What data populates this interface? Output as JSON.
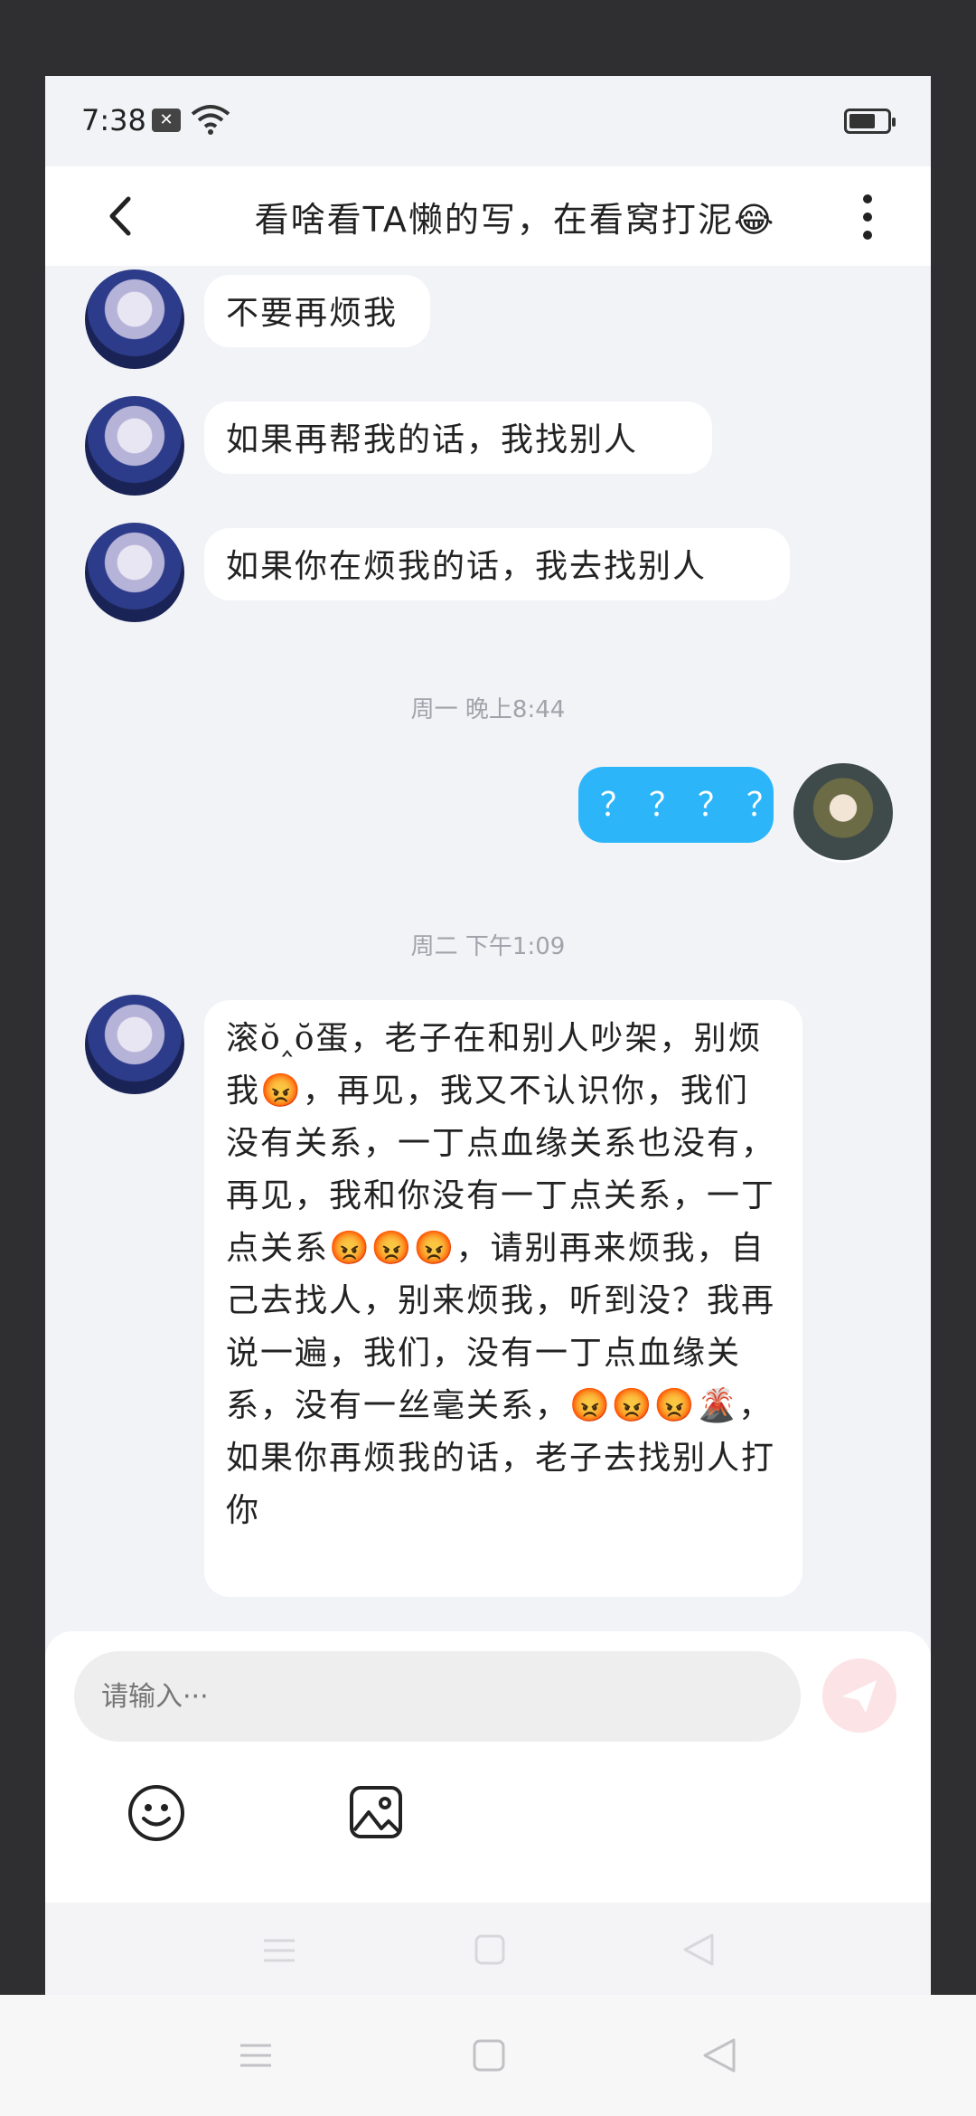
{
  "status_bar": {
    "time": "7:38",
    "sim_icon": "sim-card-icon",
    "wifi_icon": "wifi-icon",
    "battery_icon": "battery-icon"
  },
  "header": {
    "title": "看啥看TA懒的写，在看窝打泥😂",
    "back_icon": "chevron-left-icon",
    "more_icon": "more-vertical-icon"
  },
  "messages": [
    {
      "side": "them",
      "text": "不要再烦我"
    },
    {
      "side": "them",
      "text": "如果再帮我的话，我找别人"
    },
    {
      "side": "them",
      "text": "如果你在烦我的话，我去找别人"
    },
    {
      "type": "timestamp",
      "text": "周一 晚上8:44"
    },
    {
      "side": "me",
      "text": "？？？？"
    },
    {
      "type": "timestamp",
      "text": "周二 下午1:09"
    },
    {
      "side": "them",
      "text": "滚ŏ‸ŏ蛋，老子在和别人吵架，别烦我😡，再见，我又不认识你，我们没有关系，一丁点血缘关系也没有，再见，我和你没有一丁点关系，一丁点关系😡😡😡，请别再来烦我，自己去找人，别来烦我，听到没？我再说一遍，我们，没有一丁点血缘关系，没有一丝毫关系，😡😡😡🌋，如果你再烦我的话，老子去找别人打你"
    }
  ],
  "input": {
    "placeholder": "请输入···"
  },
  "toolbar": {
    "send_icon": "send-icon",
    "emoji_icon": "smiley-icon",
    "image_icon": "image-icon"
  },
  "nav": {
    "menu_icon": "menu-icon",
    "home_icon": "home-square-icon",
    "back_icon": "back-triangle-icon"
  },
  "colors": {
    "my_bubble": "#2db5fa",
    "their_bubble": "#ffffff",
    "chat_bg": "#f2f3f7",
    "send_button": "#fce3e6"
  }
}
